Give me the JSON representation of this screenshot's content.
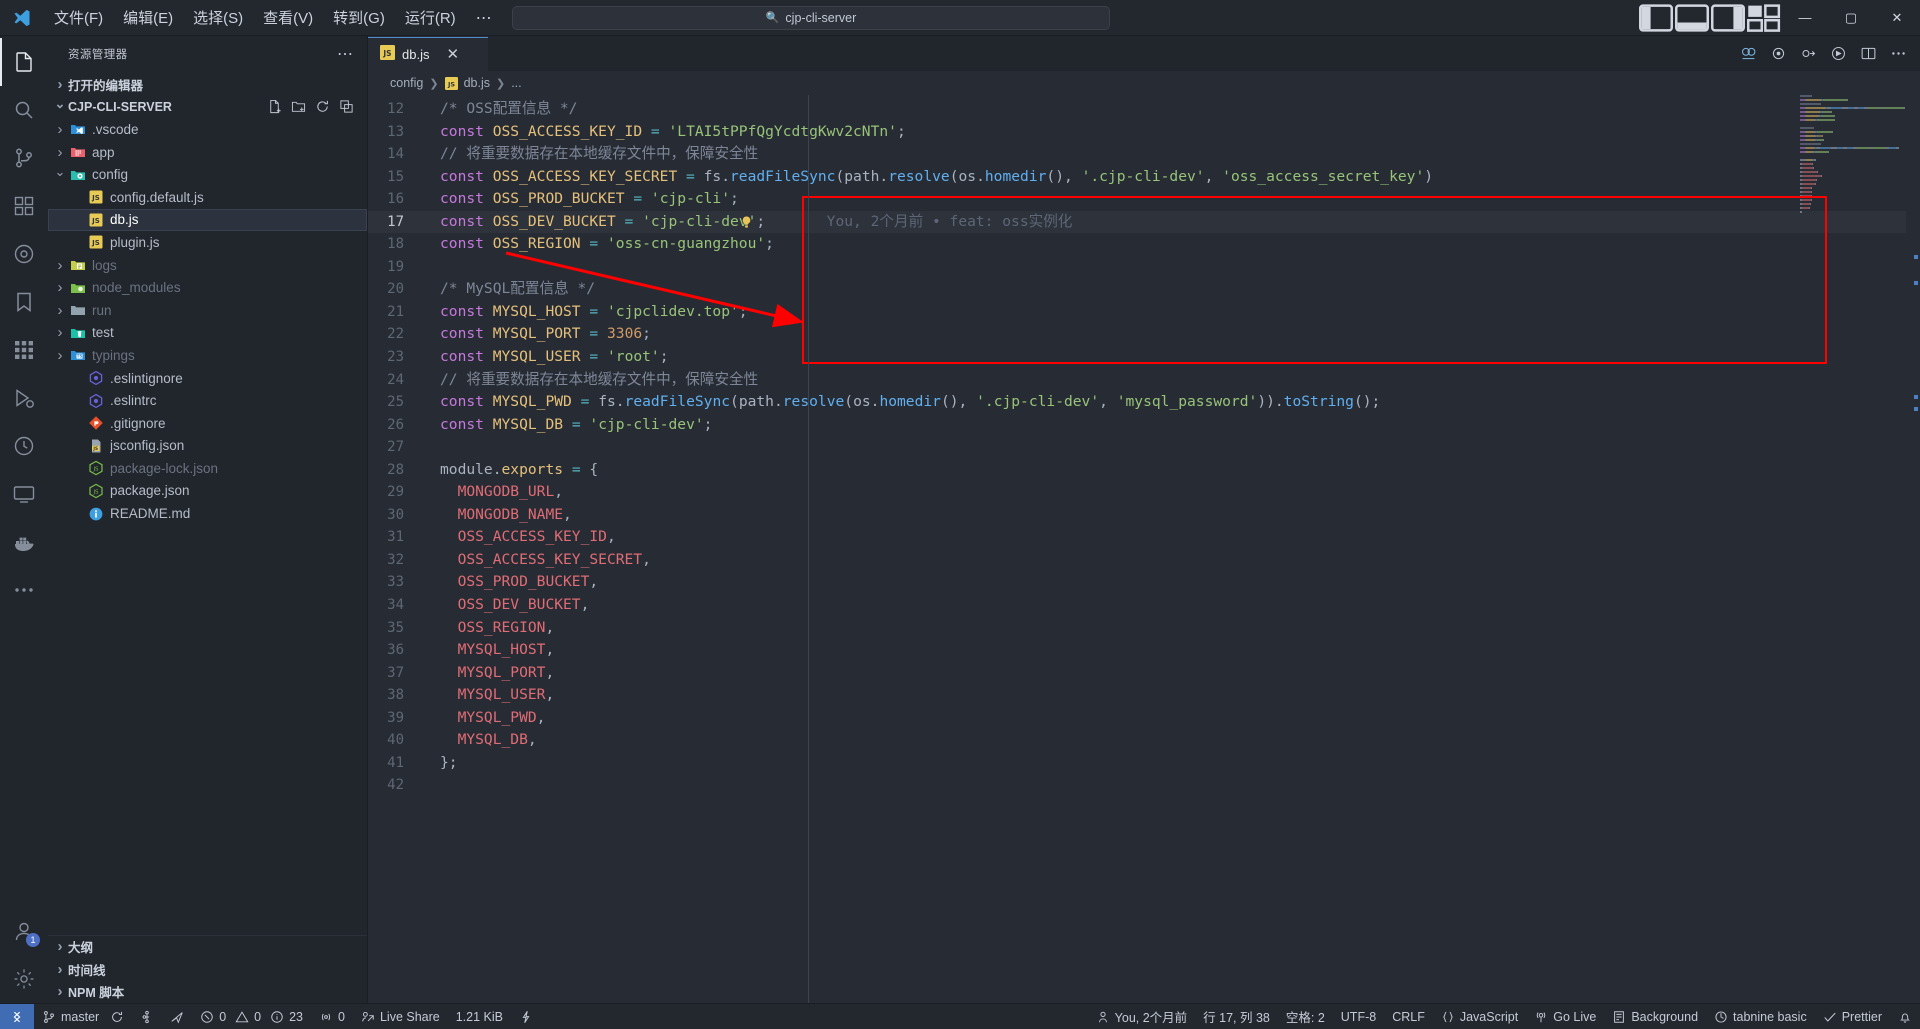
{
  "titlebar": {
    "menus": [
      "文件(F)",
      "编辑(E)",
      "选择(S)",
      "查看(V)",
      "转到(G)",
      "运行(R)"
    ],
    "overflow": "⋯",
    "back_icon": "←",
    "forward_icon": "→",
    "quickopen_text": "cjp-cli-server",
    "window_minimize": "—",
    "window_maximize": "▢",
    "window_close": "✕"
  },
  "activitybar": {
    "items": [
      {
        "name": "explorer",
        "icon": "files-icon",
        "active": true
      },
      {
        "name": "search",
        "icon": "search-icon",
        "active": false
      },
      {
        "name": "source-control",
        "icon": "source-control-icon",
        "active": false
      },
      {
        "name": "extensions",
        "icon": "extensions-icon",
        "active": false
      },
      {
        "name": "remote-explorer",
        "icon": "remote-icon",
        "active": false
      },
      {
        "name": "bookmarks",
        "icon": "bookmark-icon",
        "active": false
      },
      {
        "name": "apps-grid",
        "icon": "grid-icon",
        "active": false
      },
      {
        "name": "run-debug",
        "icon": "run-debug-icon",
        "active": false
      },
      {
        "name": "clock",
        "icon": "clock-icon",
        "active": false
      },
      {
        "name": "display",
        "icon": "display-icon",
        "active": false
      },
      {
        "name": "docker",
        "icon": "docker-icon",
        "active": false
      },
      {
        "name": "more",
        "icon": "ellipsis-icon",
        "active": false
      }
    ],
    "account_badge": "1",
    "account_icon": "account-icon",
    "settings_icon": "gear-icon"
  },
  "sidebar": {
    "title": "资源管理器",
    "more_icon": "⋯",
    "open_editors": "打开的编辑器",
    "project": "CJP-CLI-SERVER",
    "actions": [
      "new-file-icon",
      "new-folder-icon",
      "refresh-icon",
      "collapse-all-icon"
    ],
    "tree": [
      {
        "label": ".vscode",
        "depth": 2,
        "type": "folder",
        "state": "closed",
        "icon": "vscode-folder-icon",
        "dim": false
      },
      {
        "label": "app",
        "depth": 2,
        "type": "folder",
        "state": "closed",
        "icon": "app-folder-icon",
        "dim": false
      },
      {
        "label": "config",
        "depth": 2,
        "type": "folder",
        "state": "open",
        "icon": "config-folder-icon",
        "dim": false
      },
      {
        "label": "config.default.js",
        "depth": 3,
        "type": "file",
        "state": "none",
        "icon": "js-file-icon",
        "dim": false
      },
      {
        "label": "db.js",
        "depth": 3,
        "type": "file",
        "state": "none",
        "icon": "js-file-icon",
        "dim": false,
        "selected": true
      },
      {
        "label": "plugin.js",
        "depth": 3,
        "type": "file",
        "state": "none",
        "icon": "js-file-icon",
        "dim": false
      },
      {
        "label": "logs",
        "depth": 2,
        "type": "folder",
        "state": "closed",
        "icon": "logs-folder-icon",
        "dim": true
      },
      {
        "label": "node_modules",
        "depth": 2,
        "type": "folder",
        "state": "closed",
        "icon": "node-folder-icon",
        "dim": true
      },
      {
        "label": "run",
        "depth": 2,
        "type": "folder",
        "state": "closed",
        "icon": "run-folder-icon",
        "dim": true
      },
      {
        "label": "test",
        "depth": 2,
        "type": "folder",
        "state": "closed",
        "icon": "test-folder-icon",
        "dim": false
      },
      {
        "label": "typings",
        "depth": 2,
        "type": "folder",
        "state": "closed",
        "icon": "ts-folder-icon",
        "dim": true
      },
      {
        "label": ".eslintignore",
        "depth": 3,
        "type": "file",
        "state": "none",
        "icon": "eslint-file-icon",
        "dim": false
      },
      {
        "label": ".eslintrc",
        "depth": 3,
        "type": "file",
        "state": "none",
        "icon": "eslint-file-icon",
        "dim": false
      },
      {
        "label": ".gitignore",
        "depth": 3,
        "type": "file",
        "state": "none",
        "icon": "git-file-icon",
        "dim": false
      },
      {
        "label": "jsconfig.json",
        "depth": 3,
        "type": "file",
        "state": "none",
        "icon": "jsconfig-file-icon",
        "dim": false
      },
      {
        "label": "package-lock.json",
        "depth": 3,
        "type": "file",
        "state": "none",
        "icon": "npm-file-icon",
        "dim": true
      },
      {
        "label": "package.json",
        "depth": 3,
        "type": "file",
        "state": "none",
        "icon": "npm-file-icon",
        "dim": false
      },
      {
        "label": "README.md",
        "depth": 3,
        "type": "file",
        "state": "none",
        "icon": "readme-file-icon",
        "dim": false
      }
    ],
    "panels": [
      "大纲",
      "时间线",
      "NPM 脚本"
    ]
  },
  "editor": {
    "tab": {
      "label": "db.js",
      "icon": "js-file-icon",
      "close": "✕"
    },
    "tab_actions": [
      "split-editor-icon",
      "more-actions-icon",
      "run-icon",
      "debug-icon",
      "layout-icon",
      "settings-icon",
      "code-tour-icon"
    ],
    "breadcrumbs": [
      "config",
      "db.js",
      "..."
    ],
    "blame": "You, 2个月前 • feat: oss实例化",
    "lines": [
      {
        "n": 12,
        "tokens": [
          [
            "cmt",
            "/* OSS配置信息 */"
          ]
        ]
      },
      {
        "n": 13,
        "tokens": [
          [
            "kw",
            "const"
          ],
          [
            "plain",
            " "
          ],
          [
            "var",
            "OSS_ACCESS_KEY_ID"
          ],
          [
            "plain",
            " "
          ],
          [
            "op",
            "="
          ],
          [
            "plain",
            " "
          ],
          [
            "str",
            "'LTAI5tPPfQgYcdtgKwv2cNTn'"
          ],
          [
            "plain",
            ";"
          ]
        ]
      },
      {
        "n": 14,
        "tokens": [
          [
            "cmt",
            "// 将重要数据存在本地缓存文件中，保障安全性"
          ]
        ]
      },
      {
        "n": 15,
        "tokens": [
          [
            "kw",
            "const"
          ],
          [
            "plain",
            " "
          ],
          [
            "var",
            "OSS_ACCESS_KEY_SECRET"
          ],
          [
            "plain",
            " "
          ],
          [
            "op",
            "="
          ],
          [
            "plain",
            " "
          ],
          [
            "plain",
            "fs"
          ],
          [
            "plain",
            "."
          ],
          [
            "fn",
            "readFileSync"
          ],
          [
            "plain",
            "("
          ],
          [
            "plain",
            "path"
          ],
          [
            "plain",
            "."
          ],
          [
            "fn",
            "resolve"
          ],
          [
            "plain",
            "("
          ],
          [
            "plain",
            "os"
          ],
          [
            "plain",
            "."
          ],
          [
            "fn",
            "homedir"
          ],
          [
            "plain",
            "(), "
          ],
          [
            "str",
            "'.cjp-cli-dev'"
          ],
          [
            "plain",
            ", "
          ],
          [
            "str",
            "'oss_access_secret_key'"
          ],
          [
            "plain",
            ")"
          ]
        ]
      },
      {
        "n": 16,
        "tokens": [
          [
            "kw",
            "const"
          ],
          [
            "plain",
            " "
          ],
          [
            "var",
            "OSS_PROD_BUCKET"
          ],
          [
            "plain",
            " "
          ],
          [
            "op",
            "="
          ],
          [
            "plain",
            " "
          ],
          [
            "str",
            "'cjp-cli'"
          ],
          [
            "plain",
            ";"
          ]
        ]
      },
      {
        "n": 17,
        "tokens": [
          [
            "kw",
            "const"
          ],
          [
            "plain",
            " "
          ],
          [
            "var",
            "OSS_DEV_BUCKET"
          ],
          [
            "plain",
            " "
          ],
          [
            "op",
            "="
          ],
          [
            "plain",
            " "
          ],
          [
            "str",
            "'cjp-cli-dev'"
          ],
          [
            "plain",
            ";"
          ]
        ],
        "current": true,
        "bulb": true
      },
      {
        "n": 18,
        "tokens": [
          [
            "kw",
            "const"
          ],
          [
            "plain",
            " "
          ],
          [
            "var",
            "OSS_REGION"
          ],
          [
            "plain",
            " "
          ],
          [
            "op",
            "="
          ],
          [
            "plain",
            " "
          ],
          [
            "str",
            "'oss-cn-guangzhou'"
          ],
          [
            "plain",
            ";"
          ]
        ]
      },
      {
        "n": 19,
        "tokens": []
      },
      {
        "n": 20,
        "tokens": [
          [
            "cmt",
            "/* MySQL配置信息 */"
          ]
        ]
      },
      {
        "n": 21,
        "tokens": [
          [
            "kw",
            "const"
          ],
          [
            "plain",
            " "
          ],
          [
            "var",
            "MYSQL_HOST"
          ],
          [
            "plain",
            " "
          ],
          [
            "op",
            "="
          ],
          [
            "plain",
            " "
          ],
          [
            "str",
            "'cjpclidev.top'"
          ],
          [
            "plain",
            ";"
          ]
        ]
      },
      {
        "n": 22,
        "tokens": [
          [
            "kw",
            "const"
          ],
          [
            "plain",
            " "
          ],
          [
            "var",
            "MYSQL_PORT"
          ],
          [
            "plain",
            " "
          ],
          [
            "op",
            "="
          ],
          [
            "plain",
            " "
          ],
          [
            "num",
            "3306"
          ],
          [
            "plain",
            ";"
          ]
        ]
      },
      {
        "n": 23,
        "tokens": [
          [
            "kw",
            "const"
          ],
          [
            "plain",
            " "
          ],
          [
            "var",
            "MYSQL_USER"
          ],
          [
            "plain",
            " "
          ],
          [
            "op",
            "="
          ],
          [
            "plain",
            " "
          ],
          [
            "str",
            "'root'"
          ],
          [
            "plain",
            ";"
          ]
        ]
      },
      {
        "n": 24,
        "tokens": [
          [
            "cmt",
            "// 将重要数据存在本地缓存文件中，保障安全性"
          ]
        ]
      },
      {
        "n": 25,
        "tokens": [
          [
            "kw",
            "const"
          ],
          [
            "plain",
            " "
          ],
          [
            "var",
            "MYSQL_PWD"
          ],
          [
            "plain",
            " "
          ],
          [
            "op",
            "="
          ],
          [
            "plain",
            " "
          ],
          [
            "plain",
            "fs"
          ],
          [
            "plain",
            "."
          ],
          [
            "fn",
            "readFileSync"
          ],
          [
            "plain",
            "("
          ],
          [
            "plain",
            "path"
          ],
          [
            "plain",
            "."
          ],
          [
            "fn",
            "resolve"
          ],
          [
            "plain",
            "("
          ],
          [
            "plain",
            "os"
          ],
          [
            "plain",
            "."
          ],
          [
            "fn",
            "homedir"
          ],
          [
            "plain",
            "(), "
          ],
          [
            "str",
            "'.cjp-cli-dev'"
          ],
          [
            "plain",
            ", "
          ],
          [
            "str",
            "'mysql_password'"
          ],
          [
            "plain",
            "))."
          ],
          [
            "fn",
            "toString"
          ],
          [
            "plain",
            "();"
          ]
        ]
      },
      {
        "n": 26,
        "tokens": [
          [
            "kw",
            "const"
          ],
          [
            "plain",
            " "
          ],
          [
            "var",
            "MYSQL_DB"
          ],
          [
            "plain",
            " "
          ],
          [
            "op",
            "="
          ],
          [
            "plain",
            " "
          ],
          [
            "str",
            "'cjp-cli-dev'"
          ],
          [
            "plain",
            ";"
          ]
        ]
      },
      {
        "n": 27,
        "tokens": []
      },
      {
        "n": 28,
        "tokens": [
          [
            "plain",
            "module"
          ],
          [
            "plain",
            "."
          ],
          [
            "mod",
            "exports"
          ],
          [
            "plain",
            " "
          ],
          [
            "op",
            "="
          ],
          [
            "plain",
            " {"
          ]
        ]
      },
      {
        "n": 29,
        "tokens": [
          [
            "plain",
            "  "
          ],
          [
            "prop",
            "MONGODB_URL"
          ],
          [
            "plain",
            ","
          ]
        ]
      },
      {
        "n": 30,
        "tokens": [
          [
            "plain",
            "  "
          ],
          [
            "prop",
            "MONGODB_NAME"
          ],
          [
            "plain",
            ","
          ]
        ]
      },
      {
        "n": 31,
        "tokens": [
          [
            "plain",
            "  "
          ],
          [
            "prop",
            "OSS_ACCESS_KEY_ID"
          ],
          [
            "plain",
            ","
          ]
        ]
      },
      {
        "n": 32,
        "tokens": [
          [
            "plain",
            "  "
          ],
          [
            "prop",
            "OSS_ACCESS_KEY_SECRET"
          ],
          [
            "plain",
            ","
          ]
        ]
      },
      {
        "n": 33,
        "tokens": [
          [
            "plain",
            "  "
          ],
          [
            "prop",
            "OSS_PROD_BUCKET"
          ],
          [
            "plain",
            ","
          ]
        ]
      },
      {
        "n": 34,
        "tokens": [
          [
            "plain",
            "  "
          ],
          [
            "prop",
            "OSS_DEV_BUCKET"
          ],
          [
            "plain",
            ","
          ]
        ]
      },
      {
        "n": 35,
        "tokens": [
          [
            "plain",
            "  "
          ],
          [
            "prop",
            "OSS_REGION"
          ],
          [
            "plain",
            ","
          ]
        ]
      },
      {
        "n": 36,
        "tokens": [
          [
            "plain",
            "  "
          ],
          [
            "prop",
            "MYSQL_HOST"
          ],
          [
            "plain",
            ","
          ]
        ]
      },
      {
        "n": 37,
        "tokens": [
          [
            "plain",
            "  "
          ],
          [
            "prop",
            "MYSQL_PORT"
          ],
          [
            "plain",
            ","
          ]
        ]
      },
      {
        "n": 38,
        "tokens": [
          [
            "plain",
            "  "
          ],
          [
            "prop",
            "MYSQL_USER"
          ],
          [
            "plain",
            ","
          ]
        ]
      },
      {
        "n": 39,
        "tokens": [
          [
            "plain",
            "  "
          ],
          [
            "prop",
            "MYSQL_PWD"
          ],
          [
            "plain",
            ","
          ]
        ]
      },
      {
        "n": 40,
        "tokens": [
          [
            "plain",
            "  "
          ],
          [
            "prop",
            "MYSQL_DB"
          ],
          [
            "plain",
            ","
          ]
        ]
      },
      {
        "n": 41,
        "tokens": [
          [
            "plain",
            "};"
          ]
        ]
      },
      {
        "n": 42,
        "tokens": []
      }
    ]
  },
  "statusbar": {
    "remote_icon": "remote-icon",
    "branch": "master",
    "sync_icon": "sync-icon",
    "branch_icon": "branch-icon",
    "gitlens_icon": "gitlens-icon",
    "publish_icon": "publish-icon",
    "errors": "0",
    "warnings": "0",
    "infos": "23",
    "ports": "0",
    "live_share": "Live Share",
    "file_size": "1.21 KiB",
    "bolt_icon": "bolt-icon",
    "blame": "You, 2个月前",
    "position": "行 17, 列 38",
    "indent": "空格: 2",
    "encoding": "UTF-8",
    "eol": "CRLF",
    "language": "JavaScript",
    "go_live": "Go Live",
    "background": "Background",
    "tabnine": "tabnine basic",
    "prettier": "Prettier",
    "bell_icon": "bell-icon"
  }
}
